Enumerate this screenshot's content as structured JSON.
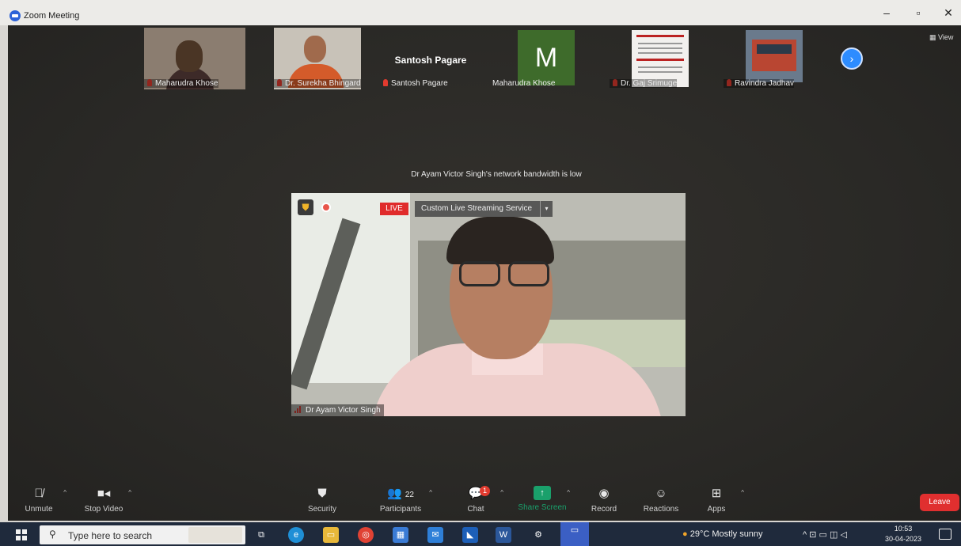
{
  "window": {
    "title": "Zoom Meeting",
    "minimize": "–",
    "maximize": "▫",
    "close": "✕"
  },
  "participants": [
    {
      "name": "Maharudra Khose"
    },
    {
      "name": "Dr. Surekha Bhingardi..."
    },
    {
      "name": "Santosh Pagare",
      "title": "Santosh Pagare"
    },
    {
      "name": "Maharudra Khose",
      "avatar_letter": "M"
    },
    {
      "name": "Dr. Gaj Srimuge"
    },
    {
      "name": "Ravindra Jadhav"
    }
  ],
  "view_label": "View",
  "notice": "Dr Ayam Victor Singh's network bandwidth is low",
  "main_video": {
    "live_label": "LIVE",
    "streaming_service": "Custom Live Streaming Service",
    "speaker_name": "Dr Ayam Victor Singh"
  },
  "toolbar": {
    "unmute": "Unmute",
    "stop_video": "Stop Video",
    "security": "Security",
    "participants": "Participants",
    "participants_count": "22",
    "chat": "Chat",
    "chat_badge": "1",
    "share_screen": "Share Screen",
    "record": "Record",
    "reactions": "Reactions",
    "apps": "Apps",
    "leave": "Leave"
  },
  "taskbar": {
    "search_placeholder": "Type here to search",
    "weather": "29°C  Mostly sunny",
    "time": "10:53",
    "date": "30-04-2023"
  },
  "colors": {
    "accent": "#2d8cff",
    "leave": "#e02f2f",
    "live": "#e02b2b",
    "share": "#1aa06b"
  }
}
